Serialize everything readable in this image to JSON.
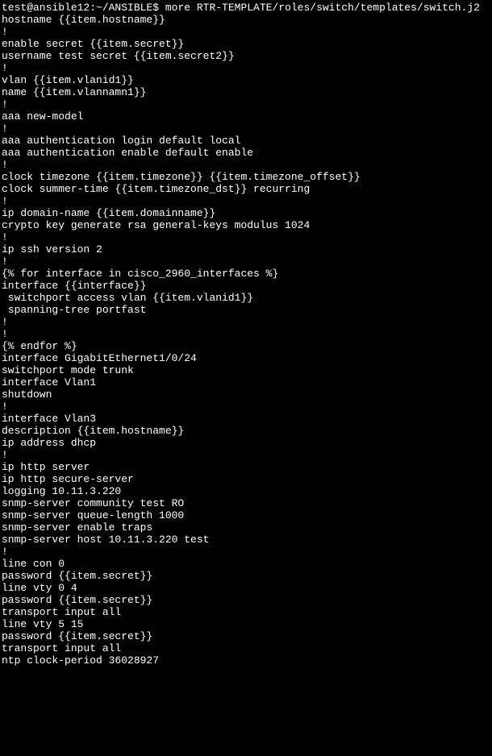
{
  "terminal": {
    "prompt": "test@ansible12:~/ANSIBLE$ ",
    "command": "more RTR-TEMPLATE/roles/switch/templates/switch.j2",
    "lines": [
      "hostname {{item.hostname}}",
      "!",
      "enable secret {{item.secret}}",
      "username test secret {{item.secret2}}",
      "!",
      "vlan {{item.vlanid1}}",
      "name {{item.vlannamn1}}",
      "!",
      "aaa new-model",
      "!",
      "aaa authentication login default local",
      "aaa authentication enable default enable",
      "!",
      "clock timezone {{item.timezone}} {{item.timezone_offset}}",
      "clock summer-time {{item.timezone_dst}} recurring",
      "!",
      "ip domain-name {{item.domainname}}",
      "crypto key generate rsa general-keys modulus 1024",
      "!",
      "ip ssh version 2",
      "!",
      "{% for interface in cisco_2960_interfaces %}",
      "interface {{interface}}",
      " switchport access vlan {{item.vlanid1}}",
      " spanning-tree portfast",
      "!",
      "!",
      "{% endfor %}",
      "",
      "interface GigabitEthernet1/0/24",
      "switchport mode trunk",
      "",
      "",
      "interface Vlan1",
      "shutdown",
      "!",
      "interface Vlan3",
      "description {{item.hostname}}",
      "ip address dhcp",
      "!",
      "ip http server",
      "ip http secure-server",
      "logging 10.11.3.220",
      "snmp-server community test RO",
      "snmp-server queue-length 1000",
      "snmp-server enable traps",
      "snmp-server host 10.11.3.220 test",
      "!",
      "line con 0",
      "password {{item.secret}}",
      "line vty 0 4",
      "password {{item.secret}}",
      "transport input all",
      "line vty 5 15",
      "password {{item.secret}}",
      "transport input all",
      "ntp clock-period 36028927"
    ]
  }
}
